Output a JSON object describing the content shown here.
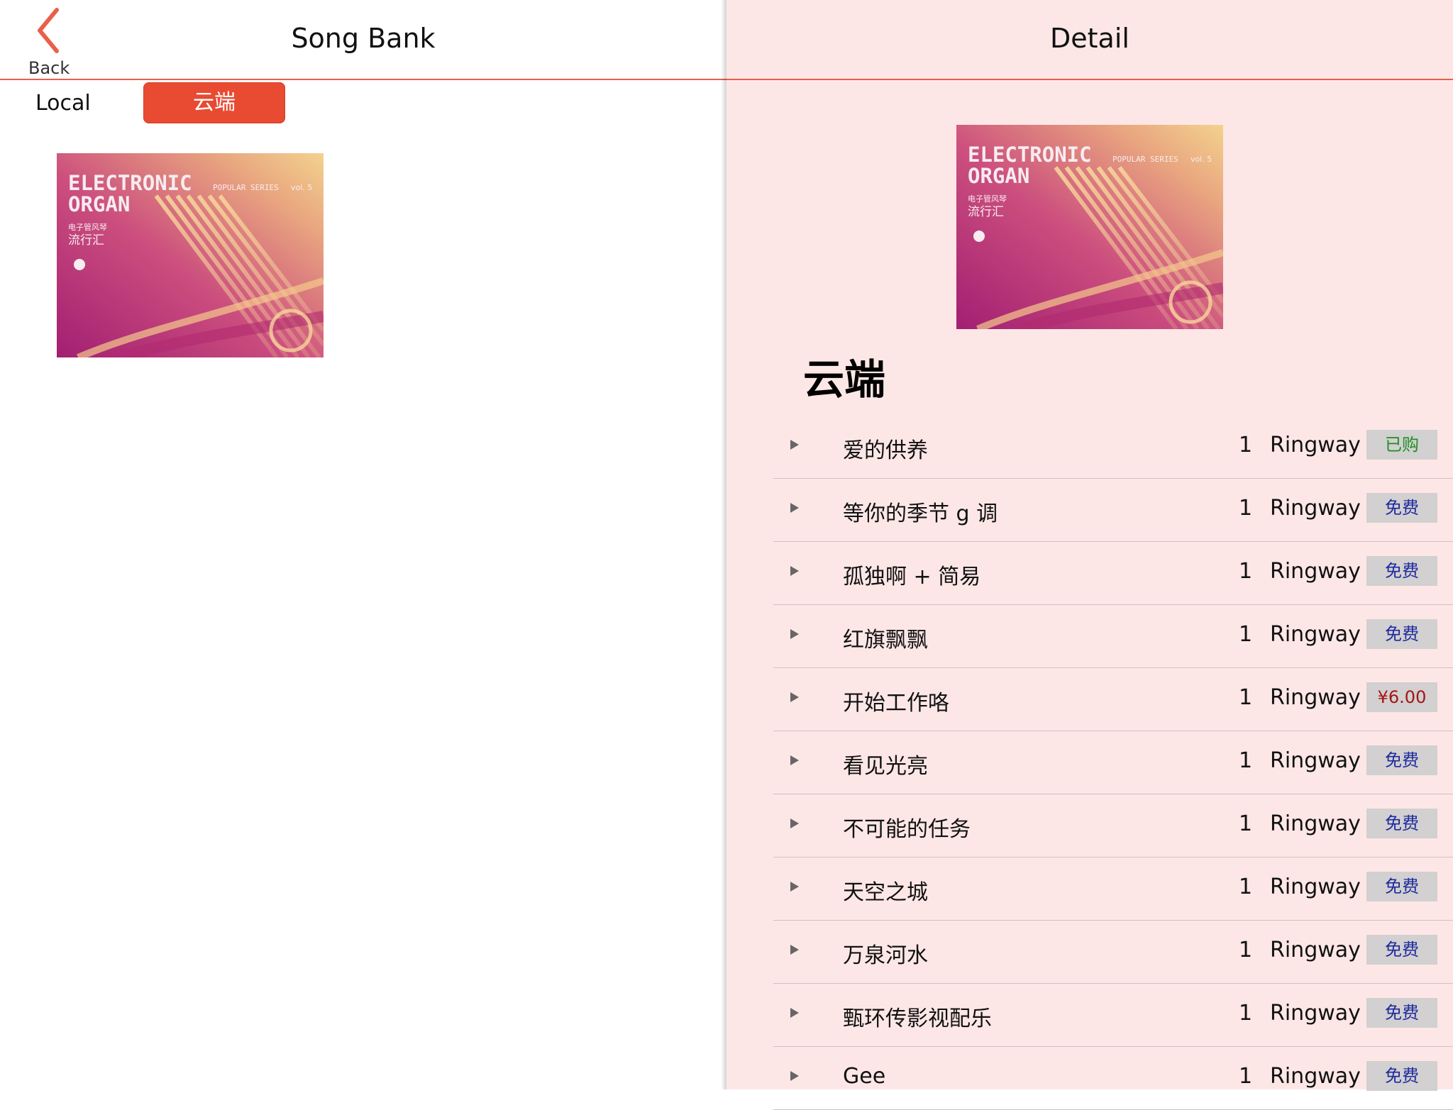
{
  "left_panel": {
    "back_label": "Back",
    "title": "Song Bank",
    "segments": {
      "local": "Local",
      "cloud": "云端"
    }
  },
  "album_art": {
    "line1": "ELECTRONIC",
    "line2": "ORGAN",
    "series": "POPULAR SERIES",
    "vol": "vol. 5",
    "cn_small": "电子管风琴",
    "cn_big": "流行汇"
  },
  "right_panel": {
    "title": "Detail",
    "album_name": "云端"
  },
  "songs": [
    {
      "title": "爱的供养",
      "count": "1",
      "author": "Ringway",
      "badge": "已购",
      "type": "bought"
    },
    {
      "title": "等你的季节 g 调",
      "count": "1",
      "author": "Ringway",
      "badge": "免费",
      "type": "free"
    },
    {
      "title": "孤独啊 + 简易",
      "count": "1",
      "author": "Ringway",
      "badge": "免费",
      "type": "free"
    },
    {
      "title": "红旗飘飘",
      "count": "1",
      "author": "Ringway",
      "badge": "免费",
      "type": "free"
    },
    {
      "title": "开始工作咯",
      "count": "1",
      "author": "Ringway",
      "badge": "¥6.00",
      "type": "price"
    },
    {
      "title": "看见光亮",
      "count": "1",
      "author": "Ringway",
      "badge": "免费",
      "type": "free"
    },
    {
      "title": "不可能的任务",
      "count": "1",
      "author": "Ringway",
      "badge": "免费",
      "type": "free"
    },
    {
      "title": "天空之城",
      "count": "1",
      "author": "Ringway",
      "badge": "免费",
      "type": "free"
    },
    {
      "title": "万泉河水",
      "count": "1",
      "author": "Ringway",
      "badge": "免费",
      "type": "free"
    },
    {
      "title": "甄环传影视配乐",
      "count": "1",
      "author": "Ringway",
      "badge": "免费",
      "type": "free"
    },
    {
      "title": "Gee",
      "count": "1",
      "author": "Ringway",
      "badge": "免费",
      "type": "free"
    }
  ],
  "colors": {
    "accent": "#e84a32",
    "detail_background": "#fde7e6",
    "free_badge_text": "#1e2a9e",
    "bought_badge_text": "#1f8f22",
    "price_badge_text": "#a51515"
  }
}
